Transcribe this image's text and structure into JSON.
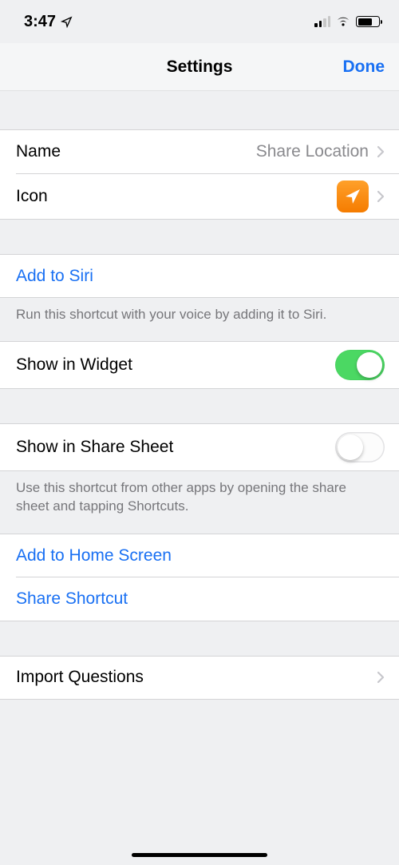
{
  "status": {
    "time": "3:47"
  },
  "nav": {
    "title": "Settings",
    "done": "Done"
  },
  "rows": {
    "name": {
      "label": "Name",
      "value": "Share Location"
    },
    "icon": {
      "label": "Icon"
    },
    "siri": {
      "label": "Add to Siri",
      "footer": "Run this shortcut with your voice by adding it to Siri."
    },
    "widget": {
      "label": "Show in Widget",
      "on": true
    },
    "sharesheet": {
      "label": "Show in Share Sheet",
      "on": false,
      "footer": "Use this shortcut from other apps by opening the share sheet and tapping Shortcuts."
    },
    "homescreen": {
      "label": "Add to Home Screen"
    },
    "shareshortcut": {
      "label": "Share Shortcut"
    },
    "import": {
      "label": "Import Questions"
    }
  }
}
